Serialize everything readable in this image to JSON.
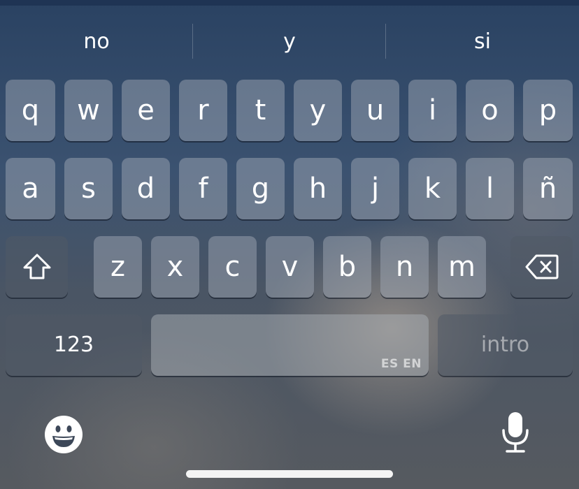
{
  "suggestions": [
    "no",
    "y",
    "si"
  ],
  "keyboard": {
    "row1": [
      "q",
      "w",
      "e",
      "r",
      "t",
      "y",
      "u",
      "i",
      "o",
      "p"
    ],
    "row2": [
      "a",
      "s",
      "d",
      "f",
      "g",
      "h",
      "j",
      "k",
      "l",
      "ñ"
    ],
    "row3": [
      "z",
      "x",
      "c",
      "v",
      "b",
      "n",
      "m"
    ],
    "numbers_label": "123",
    "space_lang_label": "ES EN",
    "return_label": "intro"
  },
  "icons": {
    "shift": "shift-icon",
    "delete": "delete-icon",
    "emoji": "emoji-icon",
    "microphone": "microphone-icon"
  }
}
